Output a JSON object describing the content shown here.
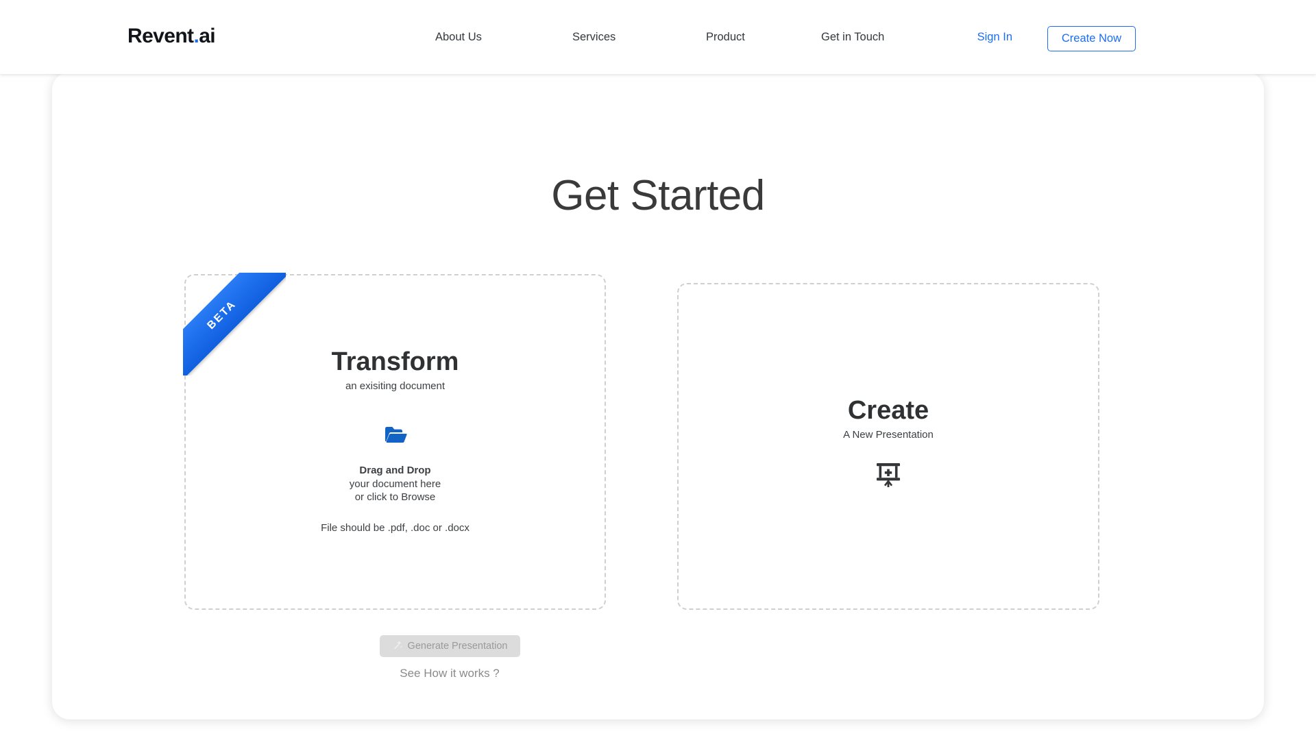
{
  "header": {
    "logo": {
      "name": "Revent",
      "dot": ".",
      "suffix": "ai"
    },
    "nav": [
      {
        "label": "About Us"
      },
      {
        "label": "Services"
      },
      {
        "label": "Product"
      },
      {
        "label": "Get in Touch"
      }
    ],
    "sign_in_label": "Sign In",
    "create_now_label": "Create Now",
    "accent_color": "#1b6ef3"
  },
  "main": {
    "page_title": "Get Started",
    "cards": {
      "transform": {
        "ribbon_label": "BETA",
        "title": "Transform",
        "subtitle": "an exisiting document",
        "dropzone": {
          "icon": "open-folder-icon",
          "headline": "Drag and Drop",
          "line2": "your document here",
          "line3": "or click to Browse"
        },
        "file_hint": "File should be .pdf, .doc or .docx"
      },
      "create": {
        "title": "Create",
        "subtitle": "A New Presentation",
        "icon": "presentation-add-icon"
      }
    },
    "generate_button": {
      "label": "Generate Presentation",
      "icon": "magic-wand-icon",
      "disabled": true
    },
    "how_it_works_label": "See How it works ?"
  },
  "colors": {
    "accent_blue": "#1b6ef3",
    "ribbon_blue": "#1a6ef0",
    "folder_blue": "#1263c6",
    "text_dark": "#2f3133",
    "text_muted": "#8a8a8a",
    "card_border": "#cfcfcf",
    "button_disabled_bg": "#dcdcdc"
  }
}
